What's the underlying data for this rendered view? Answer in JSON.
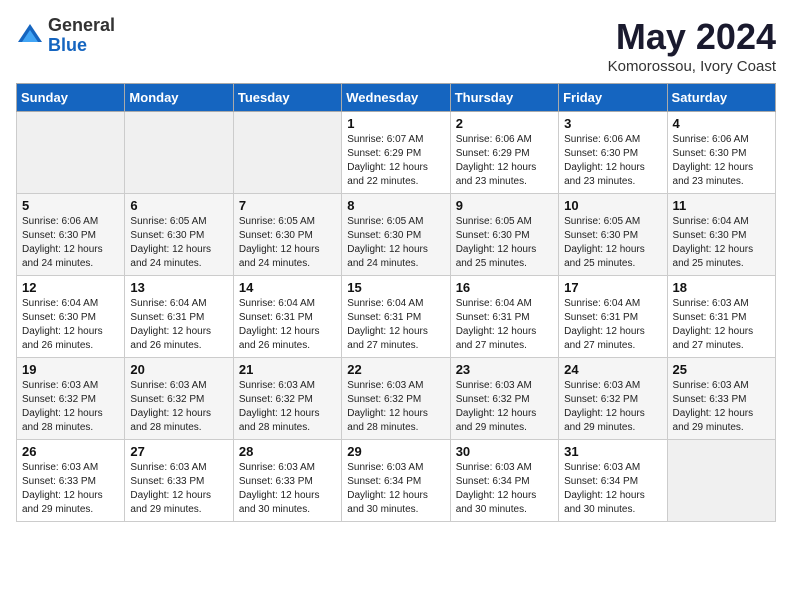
{
  "logo": {
    "general": "General",
    "blue": "Blue"
  },
  "title": "May 2024",
  "subtitle": "Komorossou, Ivory Coast",
  "days": [
    "Sunday",
    "Monday",
    "Tuesday",
    "Wednesday",
    "Thursday",
    "Friday",
    "Saturday"
  ],
  "weeks": [
    [
      {
        "num": "",
        "info": ""
      },
      {
        "num": "",
        "info": ""
      },
      {
        "num": "",
        "info": ""
      },
      {
        "num": "1",
        "info": "Sunrise: 6:07 AM\nSunset: 6:29 PM\nDaylight: 12 hours\nand 22 minutes."
      },
      {
        "num": "2",
        "info": "Sunrise: 6:06 AM\nSunset: 6:29 PM\nDaylight: 12 hours\nand 23 minutes."
      },
      {
        "num": "3",
        "info": "Sunrise: 6:06 AM\nSunset: 6:30 PM\nDaylight: 12 hours\nand 23 minutes."
      },
      {
        "num": "4",
        "info": "Sunrise: 6:06 AM\nSunset: 6:30 PM\nDaylight: 12 hours\nand 23 minutes."
      }
    ],
    [
      {
        "num": "5",
        "info": "Sunrise: 6:06 AM\nSunset: 6:30 PM\nDaylight: 12 hours\nand 24 minutes."
      },
      {
        "num": "6",
        "info": "Sunrise: 6:05 AM\nSunset: 6:30 PM\nDaylight: 12 hours\nand 24 minutes."
      },
      {
        "num": "7",
        "info": "Sunrise: 6:05 AM\nSunset: 6:30 PM\nDaylight: 12 hours\nand 24 minutes."
      },
      {
        "num": "8",
        "info": "Sunrise: 6:05 AM\nSunset: 6:30 PM\nDaylight: 12 hours\nand 24 minutes."
      },
      {
        "num": "9",
        "info": "Sunrise: 6:05 AM\nSunset: 6:30 PM\nDaylight: 12 hours\nand 25 minutes."
      },
      {
        "num": "10",
        "info": "Sunrise: 6:05 AM\nSunset: 6:30 PM\nDaylight: 12 hours\nand 25 minutes."
      },
      {
        "num": "11",
        "info": "Sunrise: 6:04 AM\nSunset: 6:30 PM\nDaylight: 12 hours\nand 25 minutes."
      }
    ],
    [
      {
        "num": "12",
        "info": "Sunrise: 6:04 AM\nSunset: 6:30 PM\nDaylight: 12 hours\nand 26 minutes."
      },
      {
        "num": "13",
        "info": "Sunrise: 6:04 AM\nSunset: 6:31 PM\nDaylight: 12 hours\nand 26 minutes."
      },
      {
        "num": "14",
        "info": "Sunrise: 6:04 AM\nSunset: 6:31 PM\nDaylight: 12 hours\nand 26 minutes."
      },
      {
        "num": "15",
        "info": "Sunrise: 6:04 AM\nSunset: 6:31 PM\nDaylight: 12 hours\nand 27 minutes."
      },
      {
        "num": "16",
        "info": "Sunrise: 6:04 AM\nSunset: 6:31 PM\nDaylight: 12 hours\nand 27 minutes."
      },
      {
        "num": "17",
        "info": "Sunrise: 6:04 AM\nSunset: 6:31 PM\nDaylight: 12 hours\nand 27 minutes."
      },
      {
        "num": "18",
        "info": "Sunrise: 6:03 AM\nSunset: 6:31 PM\nDaylight: 12 hours\nand 27 minutes."
      }
    ],
    [
      {
        "num": "19",
        "info": "Sunrise: 6:03 AM\nSunset: 6:32 PM\nDaylight: 12 hours\nand 28 minutes."
      },
      {
        "num": "20",
        "info": "Sunrise: 6:03 AM\nSunset: 6:32 PM\nDaylight: 12 hours\nand 28 minutes."
      },
      {
        "num": "21",
        "info": "Sunrise: 6:03 AM\nSunset: 6:32 PM\nDaylight: 12 hours\nand 28 minutes."
      },
      {
        "num": "22",
        "info": "Sunrise: 6:03 AM\nSunset: 6:32 PM\nDaylight: 12 hours\nand 28 minutes."
      },
      {
        "num": "23",
        "info": "Sunrise: 6:03 AM\nSunset: 6:32 PM\nDaylight: 12 hours\nand 29 minutes."
      },
      {
        "num": "24",
        "info": "Sunrise: 6:03 AM\nSunset: 6:32 PM\nDaylight: 12 hours\nand 29 minutes."
      },
      {
        "num": "25",
        "info": "Sunrise: 6:03 AM\nSunset: 6:33 PM\nDaylight: 12 hours\nand 29 minutes."
      }
    ],
    [
      {
        "num": "26",
        "info": "Sunrise: 6:03 AM\nSunset: 6:33 PM\nDaylight: 12 hours\nand 29 minutes."
      },
      {
        "num": "27",
        "info": "Sunrise: 6:03 AM\nSunset: 6:33 PM\nDaylight: 12 hours\nand 29 minutes."
      },
      {
        "num": "28",
        "info": "Sunrise: 6:03 AM\nSunset: 6:33 PM\nDaylight: 12 hours\nand 30 minutes."
      },
      {
        "num": "29",
        "info": "Sunrise: 6:03 AM\nSunset: 6:34 PM\nDaylight: 12 hours\nand 30 minutes."
      },
      {
        "num": "30",
        "info": "Sunrise: 6:03 AM\nSunset: 6:34 PM\nDaylight: 12 hours\nand 30 minutes."
      },
      {
        "num": "31",
        "info": "Sunrise: 6:03 AM\nSunset: 6:34 PM\nDaylight: 12 hours\nand 30 minutes."
      },
      {
        "num": "",
        "info": ""
      }
    ]
  ]
}
